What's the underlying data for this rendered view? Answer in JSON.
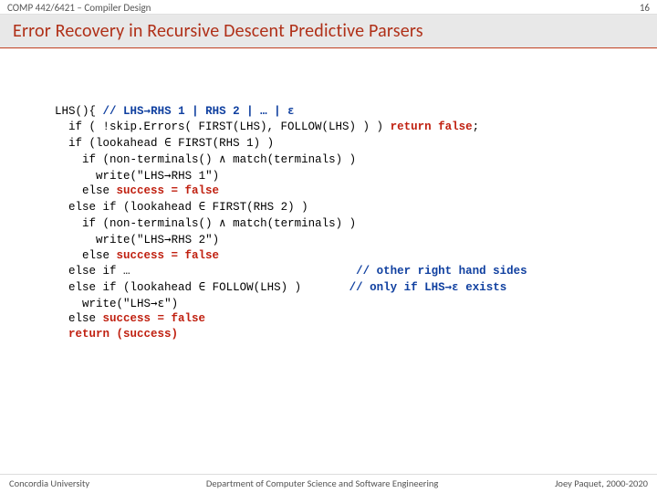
{
  "header": {
    "course": "COMP 442/6421 – Compiler Design",
    "page_no": "16"
  },
  "title": "Error Recovery in Recursive Descent Predictive Parsers",
  "code": {
    "l01a": "LHS(){ ",
    "l01b": "// LHS",
    "l01c": "RHS 1 | RHS 2 | … | ",
    "l02a": "  if ( !skip.Errors( FIRST(LHS), FOLLOW(LHS) ) ) ",
    "l02b": "return false",
    "l02c": ";",
    "l03a": "  if (lookahead ",
    "l03b": " FIRST(RHS 1) )",
    "l04a": "    if (non-terminals() ",
    "l04b": " match(terminals) )",
    "l05a": "      write(\"LHS",
    "l05b": "RHS 1\")",
    "l06a": "    else ",
    "l06b": "success = false",
    "l07a": "  else if (lookahead ",
    "l07b": " FIRST(RHS 2) )",
    "l08a": "    if (non-terminals() ",
    "l08b": " match(terminals) )",
    "l09a": "      write(\"LHS",
    "l09b": "RHS 2\")",
    "l10a": "    else ",
    "l10b": "success = false",
    "l11a": "  else if …                                 ",
    "l11b": "// other right hand sides",
    "l12a": "  else if (lookahead ",
    "l12b": " FOLLOW(LHS) )       ",
    "l12c": "// only if LHS",
    "l12d": " exists",
    "l13a": "    write(\"LHS",
    "l13b": "\")",
    "l14a": "  else ",
    "l14b": "success = false",
    "l15": "  return (success)"
  },
  "symbols": {
    "arrow": "→",
    "epsilon": "ε",
    "elem": "∈",
    "and": "∧"
  },
  "footer": {
    "left": "Concordia University",
    "center": "Department of Computer Science and Software Engineering",
    "right": "Joey Paquet, 2000-2020"
  }
}
